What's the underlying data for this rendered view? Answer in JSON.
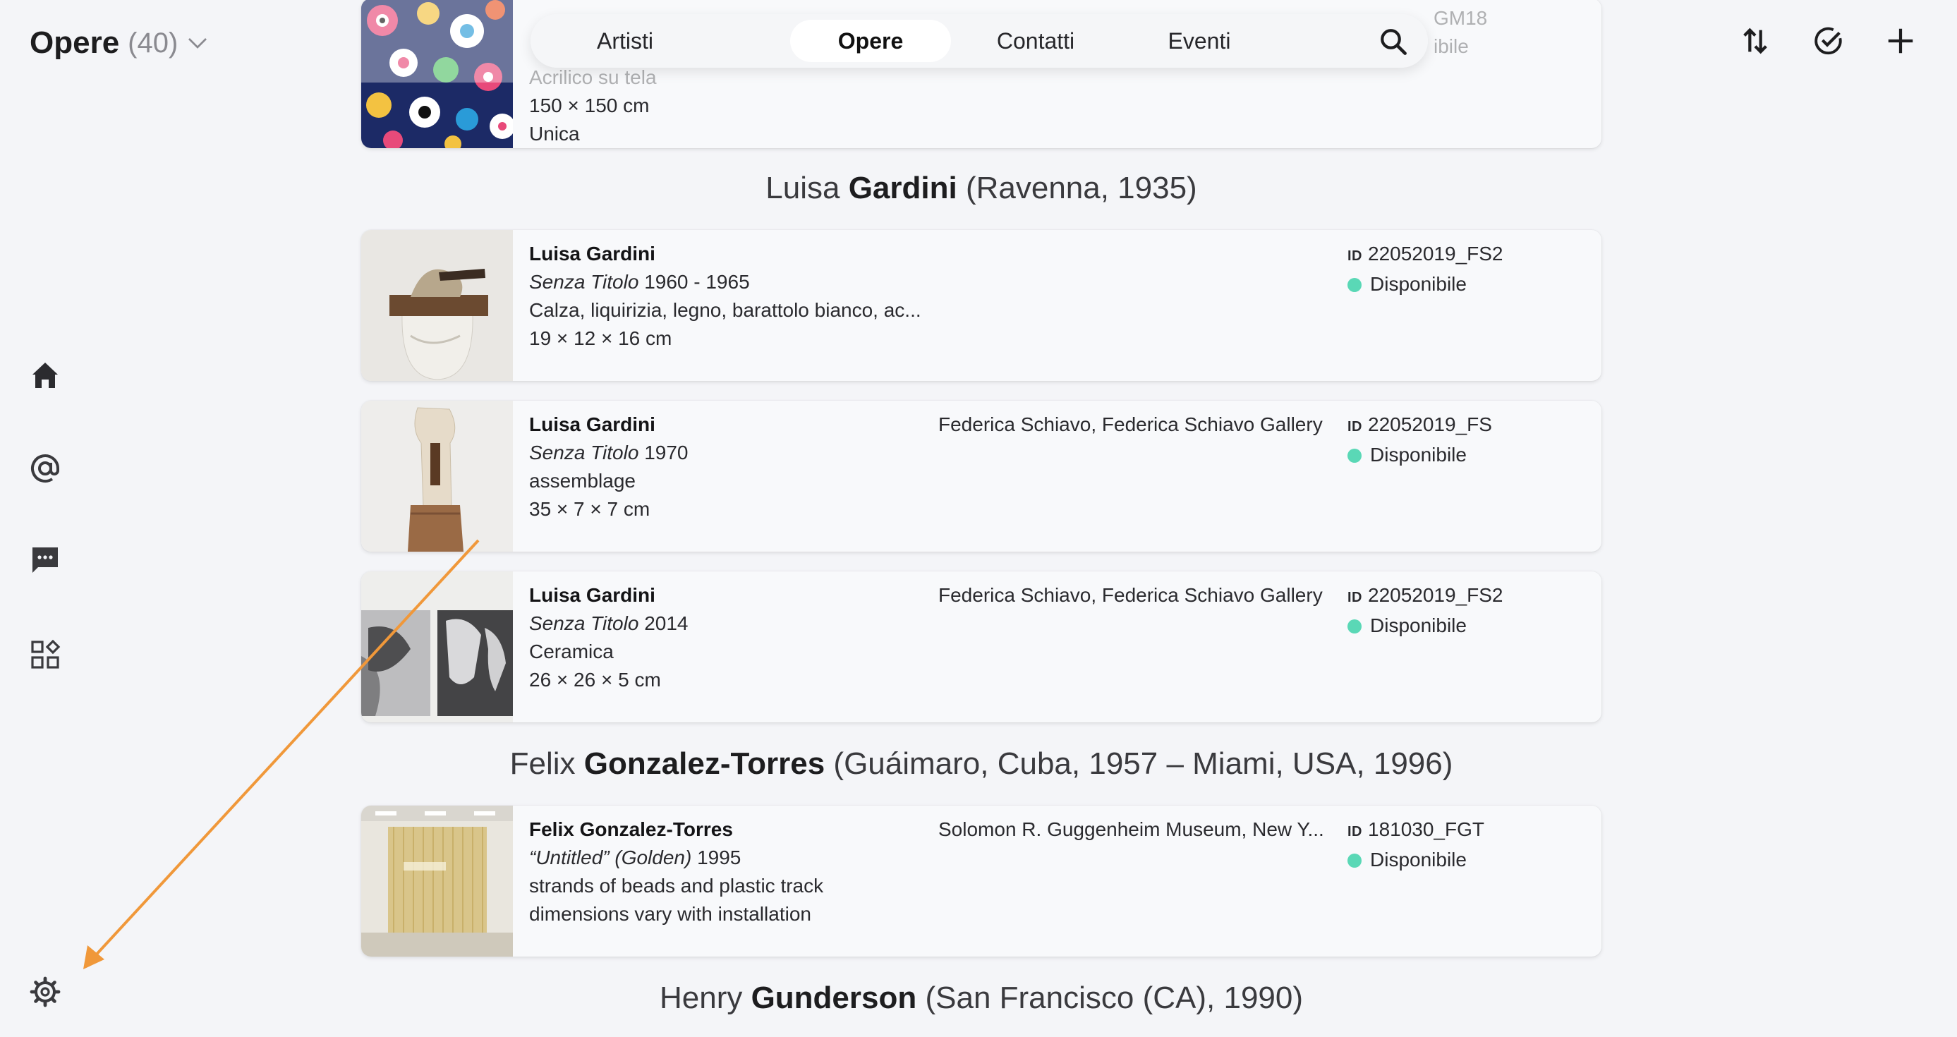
{
  "header": {
    "title": "Opere",
    "count": "(40)"
  },
  "nav": {
    "tabs": [
      {
        "label": "Artisti",
        "active": false
      },
      {
        "label": "Opere",
        "active": true
      },
      {
        "label": "Contatti",
        "active": false
      },
      {
        "label": "Eventi",
        "active": false
      }
    ],
    "search_icon": "search-icon"
  },
  "actions": [
    "sort-icon",
    "check-circle-icon",
    "plus-icon"
  ],
  "rail": [
    "home-icon",
    "at-icon",
    "chat-icon",
    "apps-icon",
    "settings-icon"
  ],
  "top_partial": {
    "line_partial": "Acrilico su tela",
    "size": "150 × 150 cm",
    "edition": "Unica",
    "id_partial": "GM18",
    "status_partial": "ibile"
  },
  "sections": [
    {
      "pre": "Luisa ",
      "surname": "Gardini",
      "post": " (Ravenna, 1935)",
      "works": [
        {
          "artist": "Luisa Gardini",
          "title": "Senza Titolo",
          "year": "1960 - 1965",
          "medium": "Calza, liquirizia, legno, barattolo bianco, ac...",
          "dims": "19 × 12 × 16 cm",
          "owner": "",
          "id_label": "ID",
          "id": "22052019_FS2",
          "status": "Disponibile"
        },
        {
          "artist": "Luisa Gardini",
          "title": "Senza Titolo",
          "year": "1970",
          "medium": "assemblage",
          "dims": "35 × 7 × 7 cm",
          "owner": "Federica Schiavo, Federica Schiavo Gallery",
          "id_label": "ID",
          "id": "22052019_FS",
          "status": "Disponibile"
        },
        {
          "artist": "Luisa Gardini",
          "title": "Senza Titolo",
          "year": "2014",
          "medium": "Ceramica",
          "dims": "26 × 26 × 5 cm",
          "owner": "Federica Schiavo, Federica Schiavo Gallery",
          "id_label": "ID",
          "id": "22052019_FS2",
          "status": "Disponibile"
        }
      ]
    },
    {
      "pre": "Felix ",
      "surname": "Gonzalez-Torres",
      "post": " (Guáimaro, Cuba, 1957 – Miami, USA, 1996)",
      "works": [
        {
          "artist": "Felix Gonzalez-Torres",
          "title": "“Untitled” (Golden)",
          "year": "1995",
          "medium": "strands of beads and plastic track",
          "dims": "dimensions vary with installation",
          "owner": "Solomon R. Guggenheim Museum, New Y...",
          "id_label": "ID",
          "id": "181030_FGT",
          "status": "Disponibile"
        }
      ]
    },
    {
      "pre": "Henry ",
      "surname": "Gunderson",
      "post": " (San Francisco (CA), 1990)",
      "works": []
    }
  ],
  "colors": {
    "background": "#f4f5f8",
    "status_available": "#5ad8b6",
    "annotation_arrow": "#f0983a"
  }
}
